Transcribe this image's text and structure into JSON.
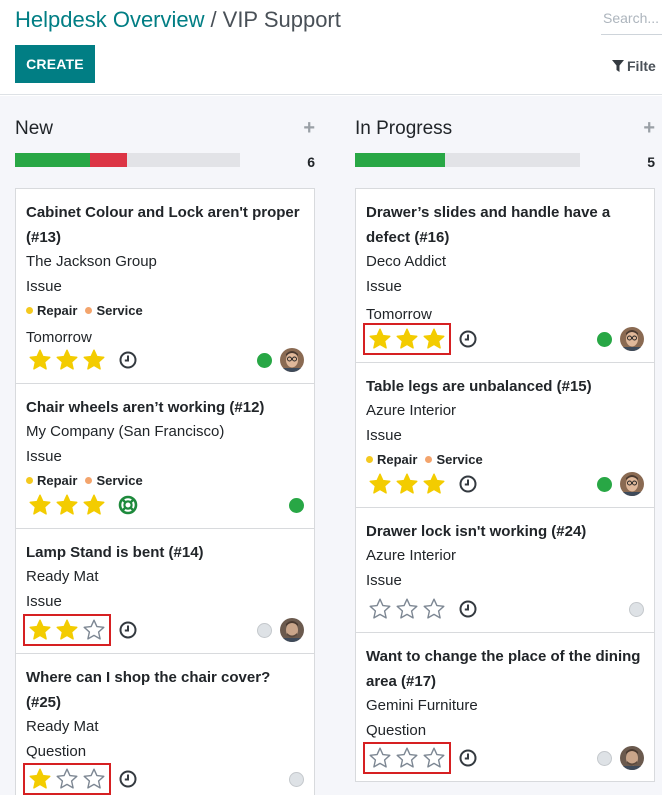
{
  "header": {
    "breadcrumb_parent": "Helpdesk Overview",
    "breadcrumb_separator": "/",
    "breadcrumb_current": "VIP Support",
    "search_placeholder": "Search...",
    "create_label": "CREATE",
    "filter_label": "Filte",
    "accent_color": "#017e84"
  },
  "columns": [
    {
      "title": "New",
      "add_icon": "plus-icon",
      "count": "6",
      "progress": {
        "green_fraction": 0.3333,
        "red_fraction": 0.1667
      },
      "cards": [
        {
          "title": "Cabinet Colour and Lock aren't proper (#13)",
          "customer": "The Jackson Group",
          "type": "Issue",
          "tags": [
            {
              "label": "Repair",
              "color": "#f4c91f"
            },
            {
              "label": "Service",
              "color": "#f3a46c"
            }
          ],
          "deadline": "Tomorrow",
          "priority_stars": 3,
          "highlighted": false,
          "activity_icon": "clock-icon",
          "state": "green",
          "avatar": "avatar-man-glasses"
        },
        {
          "title": "Chair wheels aren’t working (#12)",
          "customer": "My Company (San Francisco)",
          "type": "Issue",
          "tags": [
            {
              "label": "Repair",
              "color": "#f4c91f"
            },
            {
              "label": "Service",
              "color": "#f3a46c"
            }
          ],
          "deadline": "",
          "priority_stars": 3,
          "highlighted": false,
          "activity_icon": "lifebuoy-icon",
          "state": "green",
          "avatar": ""
        },
        {
          "title": "Lamp Stand is bent (#14)",
          "customer": "Ready Mat",
          "type": "Issue",
          "tags": [],
          "deadline": "",
          "priority_stars": 2,
          "highlighted": true,
          "activity_icon": "clock-icon",
          "state": "grey",
          "avatar": "avatar-man-beard"
        },
        {
          "title": "Where can I shop the chair cover? (#25)",
          "customer": "Ready Mat",
          "type": "Question",
          "tags": [],
          "deadline": "",
          "priority_stars": 1,
          "highlighted": true,
          "activity_icon": "clock-icon",
          "state": "grey",
          "avatar": ""
        }
      ]
    },
    {
      "title": "In Progress",
      "add_icon": "plus-icon",
      "count": "5",
      "progress": {
        "green_fraction": 0.4,
        "red_fraction": 0
      },
      "cards": [
        {
          "title": "Drawer’s slides and handle have a defect (#16)",
          "customer": "Deco Addict",
          "type": "Issue",
          "tags": [],
          "deadline": "Tomorrow",
          "priority_stars": 3,
          "highlighted": true,
          "activity_icon": "clock-icon",
          "state": "green",
          "avatar": "avatar-man-glasses"
        },
        {
          "title": "Table legs are unbalanced (#15)",
          "customer": "Azure Interior",
          "type": "Issue",
          "tags": [
            {
              "label": "Repair",
              "color": "#f4c91f"
            },
            {
              "label": "Service",
              "color": "#f3a46c"
            }
          ],
          "deadline": "",
          "priority_stars": 3,
          "highlighted": false,
          "activity_icon": "clock-icon",
          "state": "green",
          "avatar": "avatar-man-glasses"
        },
        {
          "title": "Drawer lock isn't working (#24)",
          "customer": "Azure Interior",
          "type": "Issue",
          "tags": [],
          "deadline": "",
          "priority_stars": 0,
          "highlighted": false,
          "activity_icon": "clock-icon",
          "state": "grey",
          "avatar": ""
        },
        {
          "title": "Want to change the place of the dining area (#17)",
          "customer": "Gemini Furniture",
          "type": "Question",
          "tags": [],
          "deadline": "",
          "priority_stars": 0,
          "highlighted": true,
          "activity_icon": "clock-icon",
          "state": "grey",
          "avatar": "avatar-man-beard"
        }
      ]
    }
  ],
  "colors": {
    "star_filled": "#f3cc00",
    "star_empty_stroke": "#7d8793",
    "state_green": "#28a745",
    "progress_green": "#28a745",
    "progress_red": "#dc3545",
    "highlight_box": "#d62022"
  }
}
